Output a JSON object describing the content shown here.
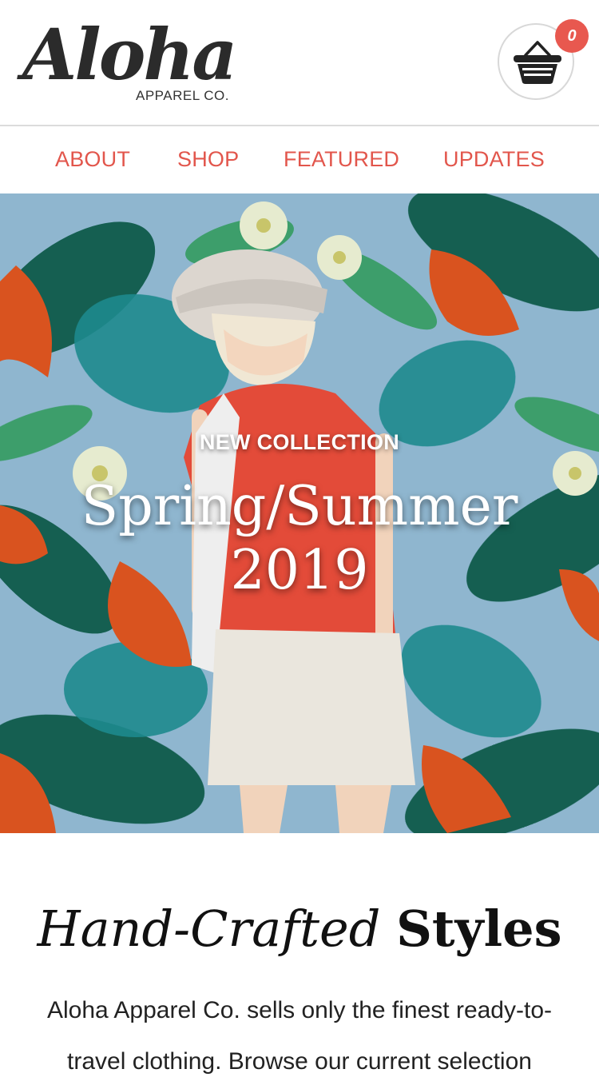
{
  "brand": {
    "script": "Aloha",
    "sub": "APPAREL CO."
  },
  "cart": {
    "count": "0"
  },
  "nav": [
    {
      "label": "ABOUT"
    },
    {
      "label": "SHOP"
    },
    {
      "label": "FEATURED"
    },
    {
      "label": "UPDATES"
    }
  ],
  "hero": {
    "kicker": "NEW COLLECTION",
    "title_line1": "Spring/Summer",
    "title_line2": "2019"
  },
  "content": {
    "title_italic": "Hand-Crafted",
    "title_bold": "Styles",
    "body": "Aloha Apparel Co. sells only the finest ready-to-travel clothing. Browse our current selection"
  },
  "colors": {
    "accent": "#e2564c",
    "badge": "#e8584f",
    "hero_bg": "#8fb6cf"
  }
}
